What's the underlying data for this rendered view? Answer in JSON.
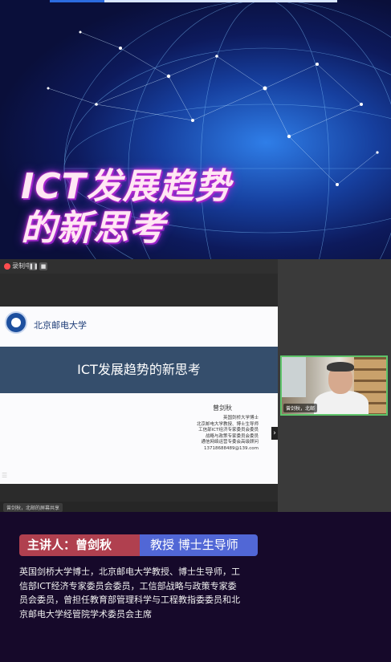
{
  "hero": {
    "title_line1": "ICT发展趋势",
    "title_line2": "的新思考"
  },
  "meeting": {
    "rec_label": "录制中",
    "pause_icon": "pause-icon",
    "stop_icon": "stop-icon",
    "participant_label": "曾剑秋，北邮",
    "share_label": "曾剑秋，北邮的屏幕共享",
    "menu_icon": "menu-icon"
  },
  "slide": {
    "university": "北京邮电大学",
    "title": "ICT发展趋势的新思考",
    "presenter": "曾剑秋",
    "info": [
      "英国剑桥大学博士",
      "北京邮电大学教授、博士生导师",
      "工信部ICT经济专家委员会委员",
      "战略与政策专家委员会委员",
      "通信网络运营专委会高级顾问",
      "13718688489@139.com"
    ]
  },
  "banner": {
    "speaker": "主讲人：曾剑秋",
    "title": "教授  博士生导师"
  },
  "bio": [
    "英国剑桥大学博士，北京邮电大学教授、博士生导师，工",
    "信部ICT经济专家委员会委员，工信部战略与政策专家委",
    "员会委员，曾担任教育部管理科学与工程教指委委员和北",
    "京邮电大学经管院学术委员会主席"
  ],
  "colors": {
    "banner_red": "#b0404f",
    "banner_blue": "#5167d6",
    "slide_band": "#354e6c",
    "page_bg": "#16092a"
  }
}
